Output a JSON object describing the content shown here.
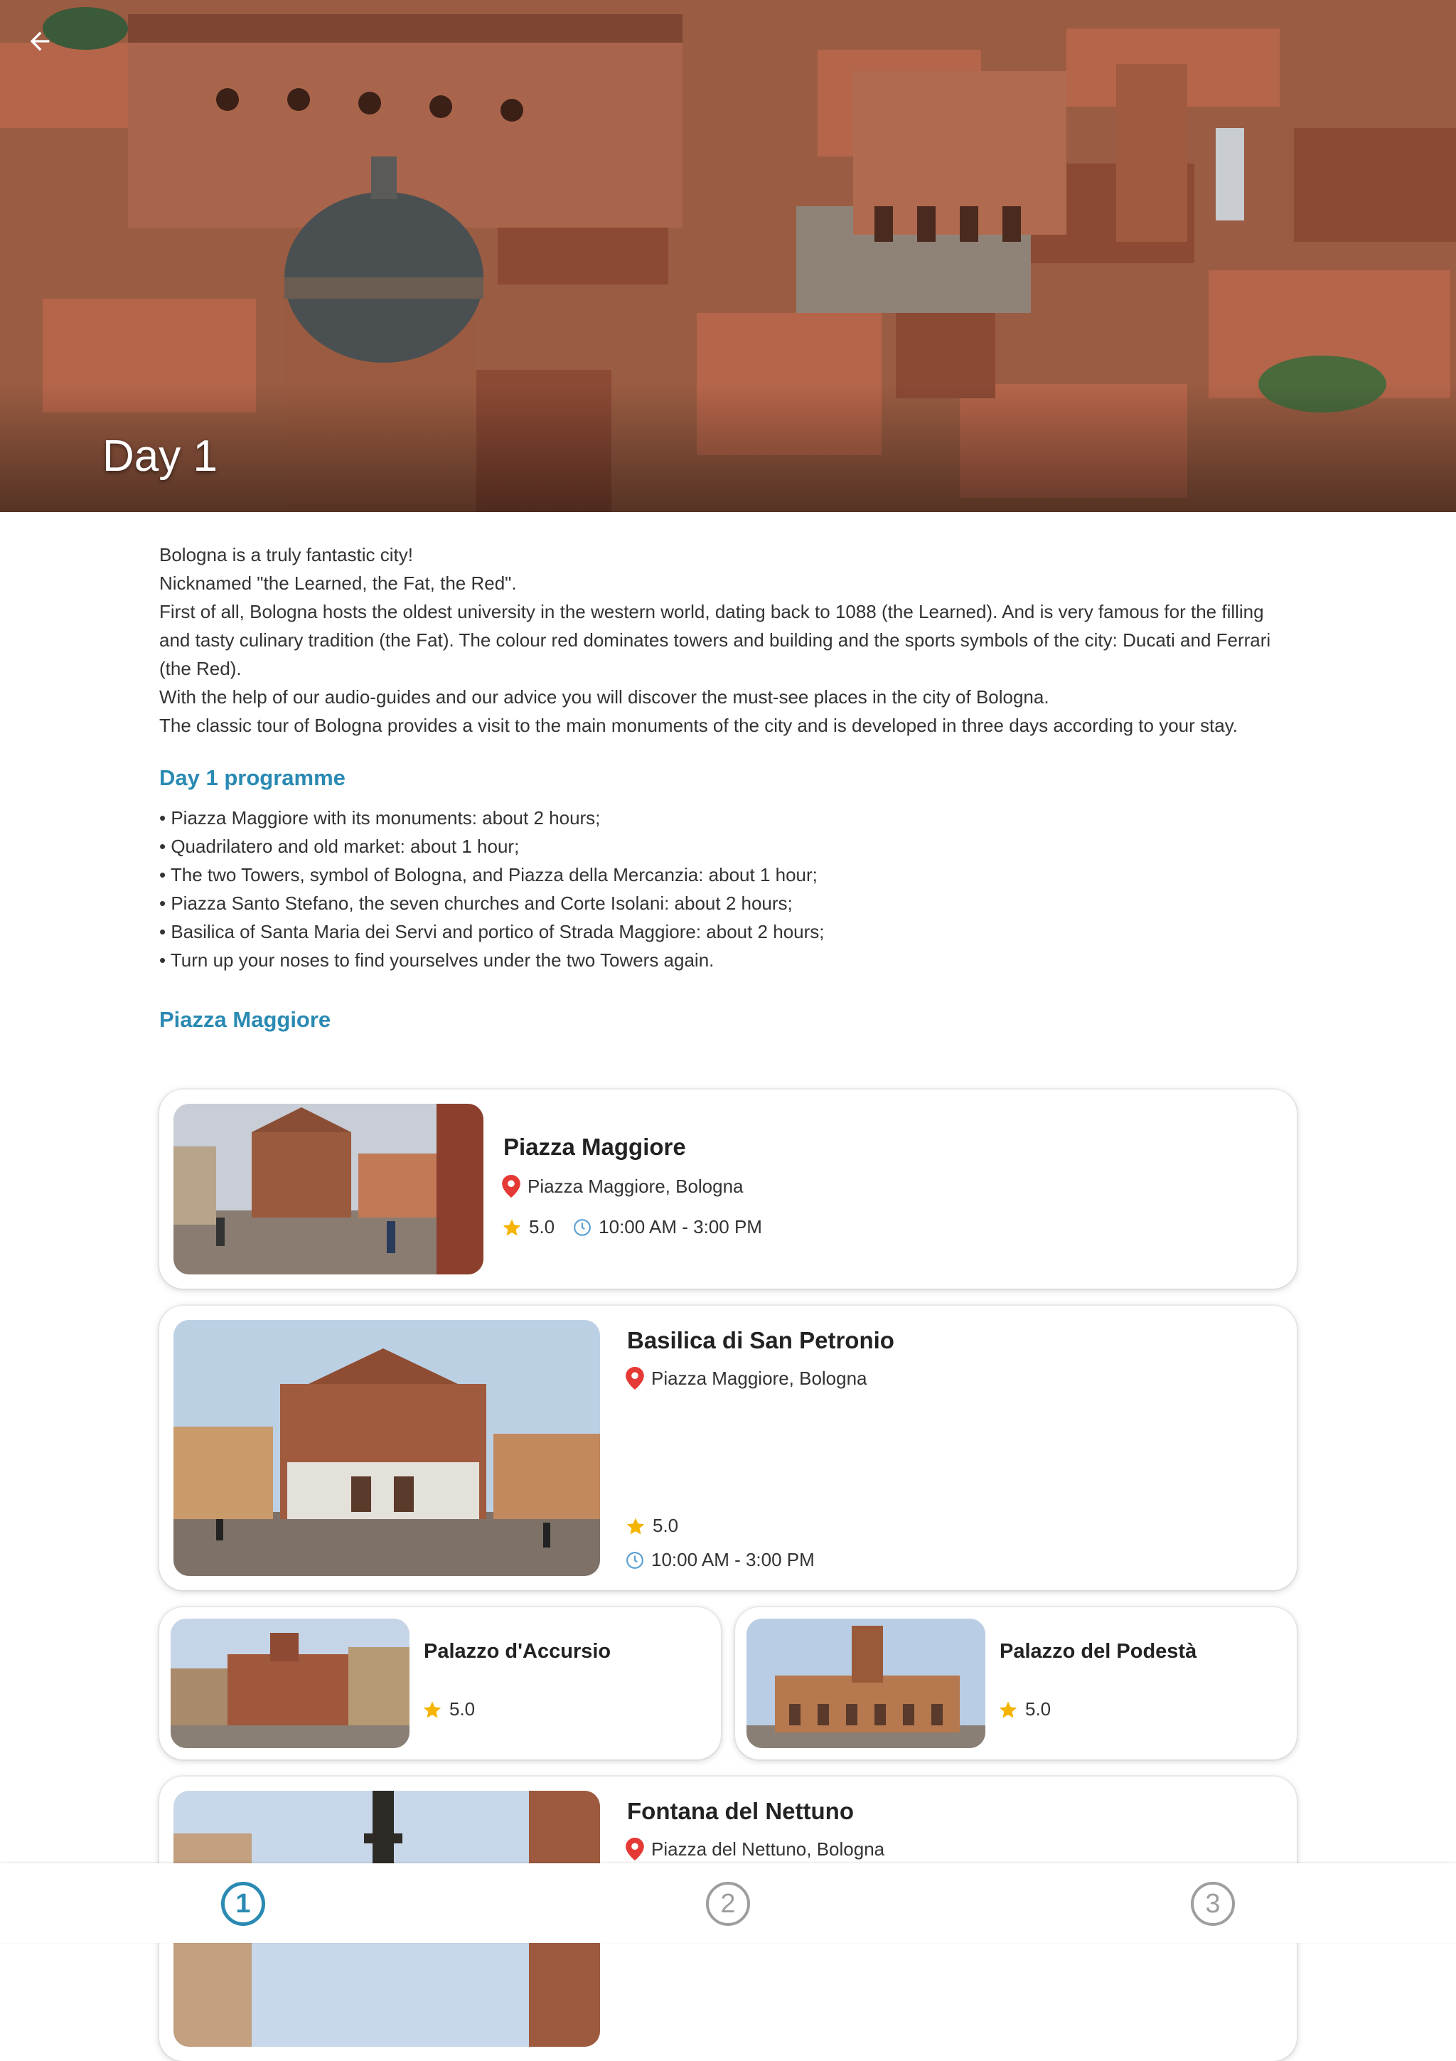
{
  "header": {
    "back_icon": "arrow-left-icon",
    "title": "Day 1"
  },
  "intro": {
    "paragraphs": [
      "Bologna is a truly fantastic city!",
      "Nicknamed \"the Learned, the Fat, the Red\".",
      "First of all, Bologna hosts the oldest university in the western world, dating back to 1088 (the Learned). And is very famous for the filling and tasty culinary tradition (the Fat). The colour red dominates towers and building and the sports symbols of the city: Ducati and Ferrari (the Red).",
      "With the help of our audio-guides and our advice you will discover the must-see places in the city of Bologna.",
      "The classic tour of Bologna provides a visit to the main monuments of the city and is developed in three days according to your stay."
    ]
  },
  "programme": {
    "title": "Day 1 programme",
    "items": [
      "Piazza Maggiore with its monuments:  about 2 hours;",
      "Quadrilatero and old market: about 1 hour;",
      "The two Towers, symbol of Bologna, and Piazza della Mercanzia: about 1 hour;",
      "Piazza Santo Stefano, the seven churches and Corte Isolani: about 2 hours;",
      "Basilica of Santa Maria dei Servi and portico of Strada Maggiore: about 2 hours;",
      "Turn up your noses to find yourselves under the two Towers again."
    ]
  },
  "section": {
    "title": "Piazza Maggiore"
  },
  "places": [
    {
      "name": "Piazza Maggiore",
      "location": "Piazza Maggiore, Bologna",
      "rating": "5.0",
      "hours": "10:00 AM - 3:00 PM"
    },
    {
      "name": "Basilica di San Petronio",
      "location": "Piazza Maggiore, Bologna",
      "rating": "5.0",
      "hours": "10:00 AM - 3:00 PM"
    },
    {
      "name": "Palazzo d'Accursio",
      "rating": "5.0"
    },
    {
      "name": "Palazzo del Podestà",
      "rating": "5.0"
    },
    {
      "name": "Fontana del Nettuno",
      "location": "Piazza del Nettuno, Bologna"
    }
  ],
  "bottom_nav": {
    "items": [
      "1",
      "2",
      "3"
    ],
    "active_index": 0,
    "active_color": "#2a8ab3",
    "inactive_color": "#9e9e9e"
  },
  "colors": {
    "accent": "#2a8ab3",
    "star": "#f5b400",
    "pin": "#e53935"
  }
}
